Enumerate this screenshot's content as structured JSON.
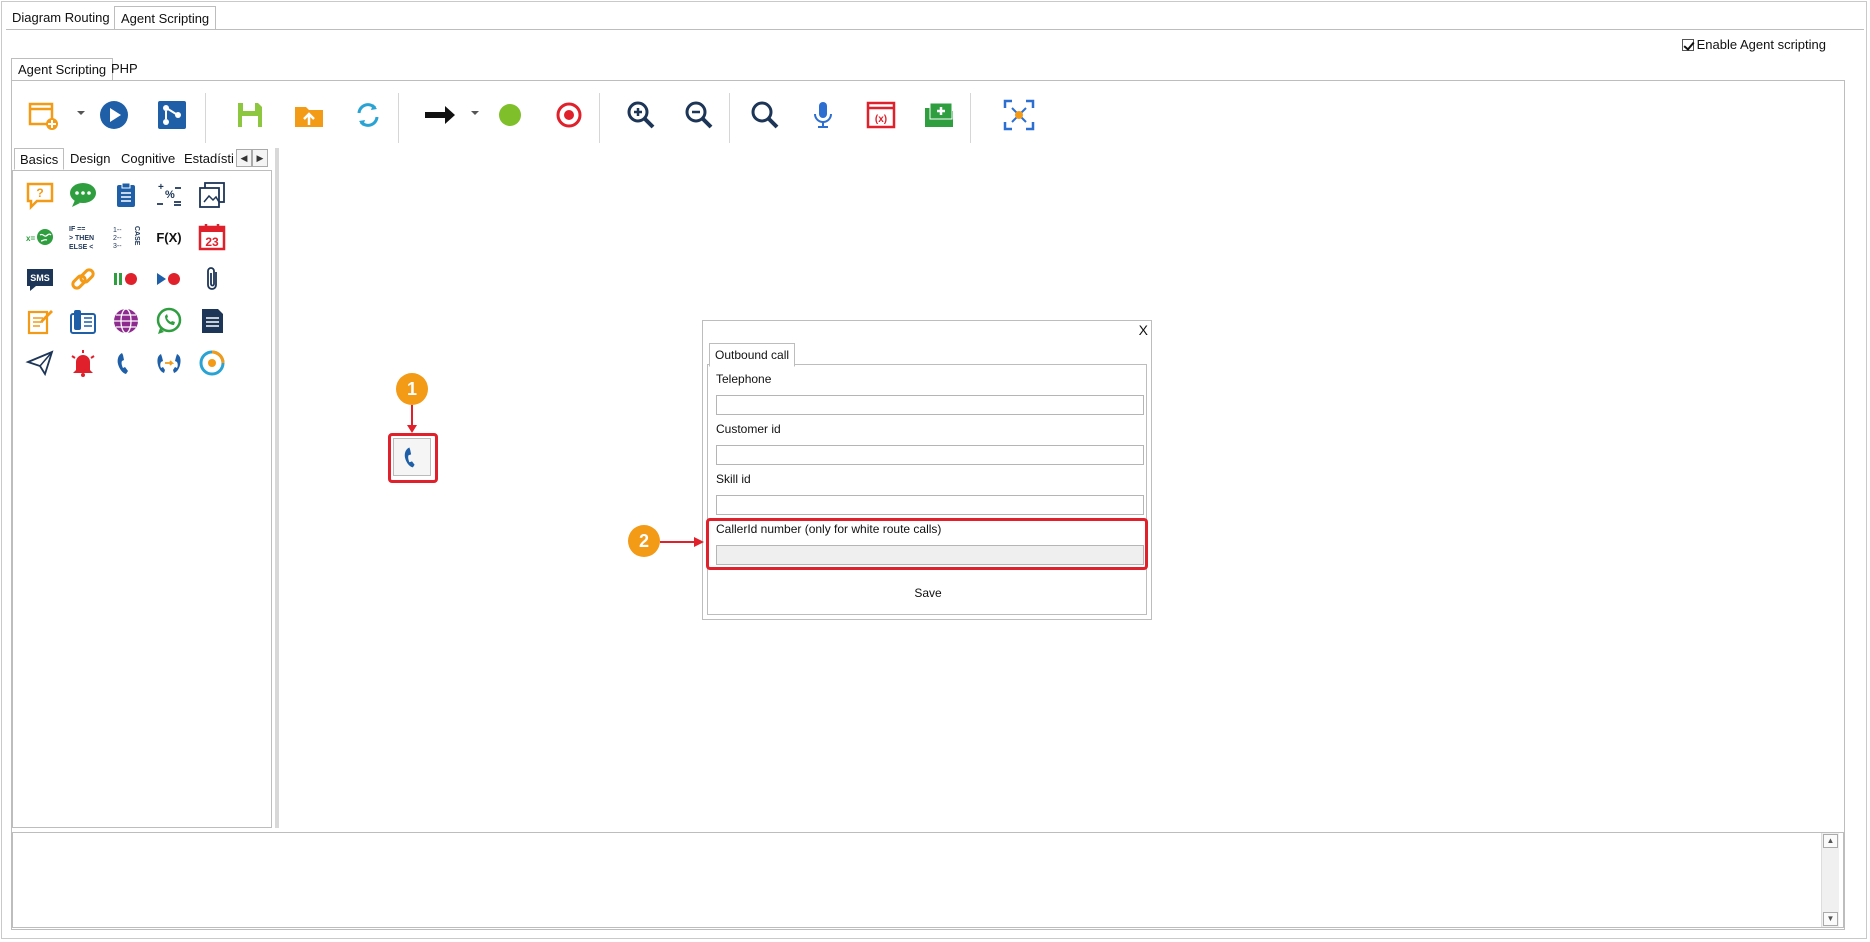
{
  "top_tabs": [
    {
      "label": "Diagram Routing",
      "active": false
    },
    {
      "label": "Agent Scripting",
      "active": true
    }
  ],
  "enable_checkbox": {
    "label": "Enable Agent scripting",
    "checked": true
  },
  "inner_tabs": [
    {
      "label": "Agent Scripting",
      "active": true
    },
    {
      "label": "PHP",
      "active": false
    }
  ],
  "toolbar": {
    "items": [
      "new-script-icon",
      "run-icon",
      "flow-icon",
      "save-icon",
      "open-folder-icon",
      "refresh-icon",
      "arrow-connector-icon",
      "green-dot-icon",
      "red-target-icon",
      "zoom-in-icon",
      "zoom-out-icon",
      "search-icon",
      "microphone-icon",
      "variables-icon",
      "add-folder-icon",
      "fit-screen-icon"
    ]
  },
  "palette": {
    "tabs": [
      "Basics",
      "Design",
      "Cognitive",
      "Estadísti"
    ],
    "active_tab": "Basics",
    "rows": [
      [
        "question-bubble-icon",
        "chat-bubble-icon",
        "clipboard-icon",
        "math-operations-icon",
        "images-icon"
      ],
      [
        "globe-variable-icon",
        "if-then-else-icon",
        "case-icon",
        "function-icon",
        "calendar-icon"
      ],
      [
        "sms-icon",
        "link-icon",
        "pause-record-icon",
        "play-record-icon",
        "attachment-icon"
      ],
      [
        "note-icon",
        "fax-phone-icon",
        "web-icon",
        "whatsapp-icon",
        "document-icon"
      ],
      [
        "send-icon",
        "alarm-icon",
        "phone-icon",
        "transfer-call-icon",
        "target-circle-icon"
      ]
    ],
    "calendar_number": "23",
    "function_text": "F(X)",
    "sms_text": "SMS",
    "if_text": [
      "IF ==",
      "> THEN",
      "ELSE <"
    ],
    "case_text": "CASE"
  },
  "canvas": {
    "badge1": "1",
    "badge2": "2"
  },
  "dialog": {
    "close_label": "X",
    "tab_label": "Outbound call",
    "fields": [
      {
        "label": "Telephone",
        "value": ""
      },
      {
        "label": "Customer id",
        "value": ""
      },
      {
        "label": "Skill id",
        "value": ""
      },
      {
        "label": "CallerId number  (only for white route calls)",
        "value": ""
      }
    ],
    "save_label": "Save"
  },
  "colors": {
    "accent_red": "#e0202a",
    "badge_orange": "#f39a16",
    "icon_blue": "#1e5fa8",
    "icon_orange": "#f39a16",
    "icon_green": "#2e9e3f"
  }
}
